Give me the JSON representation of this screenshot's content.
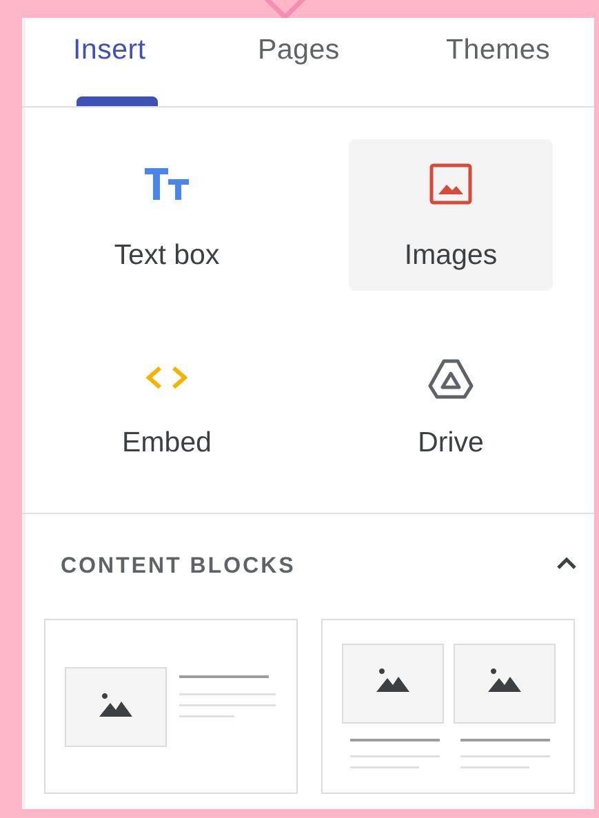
{
  "tabs": [
    {
      "label": "Insert",
      "active": true
    },
    {
      "label": "Pages",
      "active": false
    },
    {
      "label": "Themes",
      "active": false
    }
  ],
  "insert_items": [
    {
      "label": "Text box",
      "icon": "text-box-icon",
      "color": "#4a86e8"
    },
    {
      "label": "Images",
      "icon": "image-icon",
      "color": "#d64a3b"
    },
    {
      "label": "Embed",
      "icon": "embed-code-icon",
      "color": "#f4b400"
    },
    {
      "label": "Drive",
      "icon": "google-drive-icon",
      "color": "#5f6368"
    }
  ],
  "content_blocks": {
    "title": "CONTENT BLOCKS",
    "expanded": true,
    "layouts": [
      "image-left-text-right",
      "two-images-with-captions"
    ]
  },
  "colors": {
    "accent": "#3f51b5",
    "frame": "#ffb6c8"
  }
}
